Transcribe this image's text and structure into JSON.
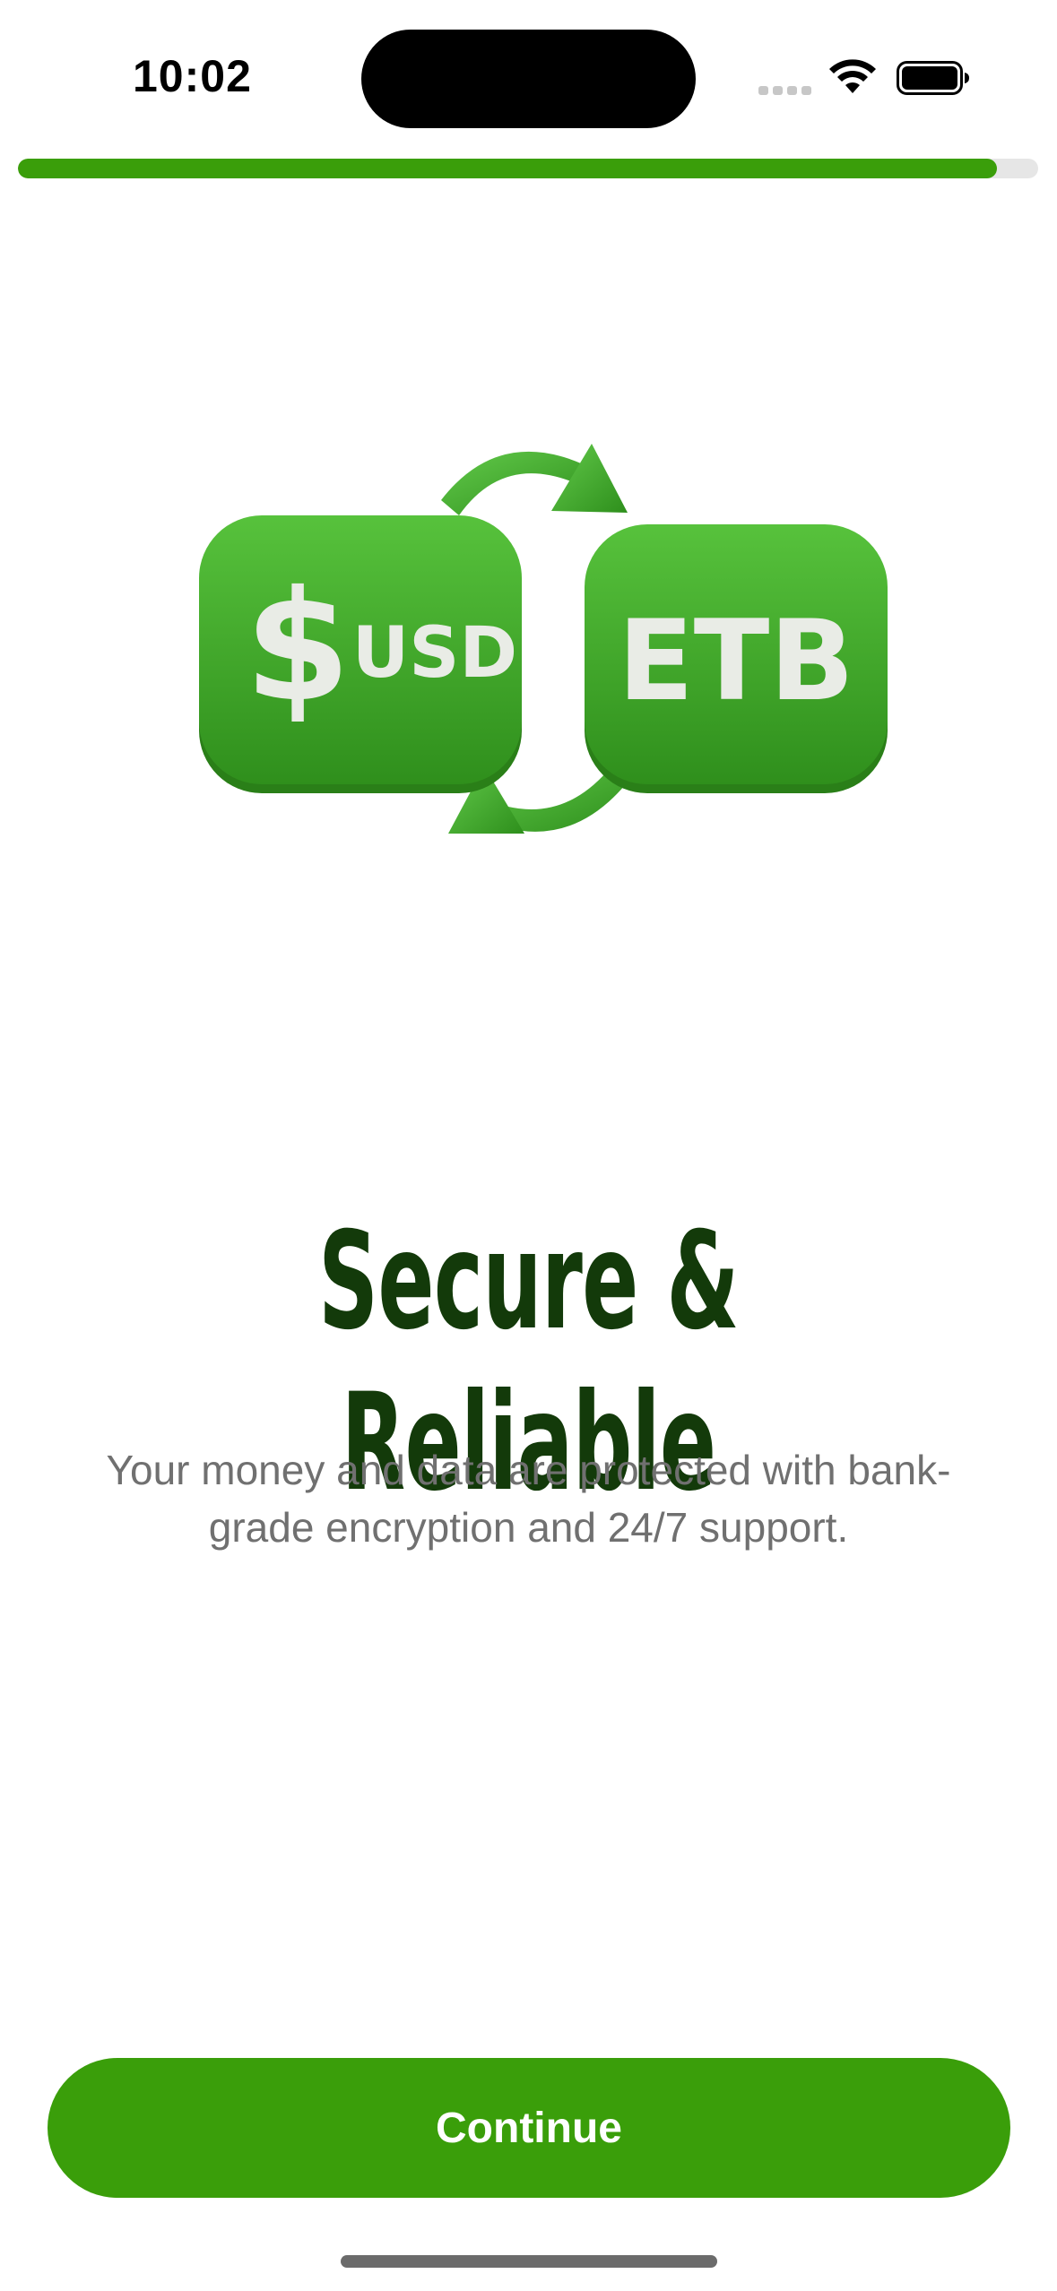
{
  "status_bar": {
    "time": "10:02"
  },
  "progress": {
    "fraction": 0.96,
    "color": "#3a9e0a"
  },
  "illustration": {
    "left_currency_symbol": "$",
    "left_currency_code": "USD",
    "right_currency_code": "ETB",
    "accent": "#3fa82a"
  },
  "onboarding": {
    "title": "Secure & Reliable",
    "description_line1": "Your money and data are protected with bank-",
    "description_line2": "grade encryption and 24/7 support.",
    "continue_label": "Continue"
  },
  "colors": {
    "primary": "#3a9e0a",
    "title": "#133a0a",
    "body_text": "#707070"
  }
}
